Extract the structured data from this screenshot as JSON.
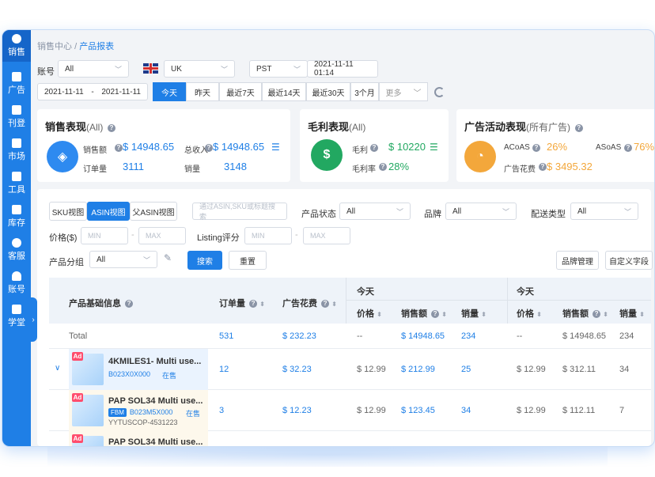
{
  "sidebar": {
    "items": [
      {
        "label": "销售",
        "icon": "pie-chart-icon"
      },
      {
        "label": "广告",
        "icon": "ad-icon"
      },
      {
        "label": "刊登",
        "icon": "document-icon"
      },
      {
        "label": "市场",
        "icon": "market-icon"
      },
      {
        "label": "工具",
        "icon": "tools-icon"
      },
      {
        "label": "库存",
        "icon": "warehouse-icon"
      },
      {
        "label": "客服",
        "icon": "headset-icon"
      },
      {
        "label": "账号",
        "icon": "user-icon"
      },
      {
        "label": "学堂",
        "icon": "classroom-icon"
      }
    ],
    "expand_arrow": "›"
  },
  "breadcrumb": {
    "root": "销售中心",
    "sep": "/",
    "current": "产品报表"
  },
  "filters": {
    "account_label": "账号",
    "account_value": "All",
    "site_value": "UK",
    "tz_value": "PST",
    "now_time": "2021-11-11 01:14",
    "date_start": "2021-11-11",
    "date_sep": "-",
    "date_end": "2021-11-11",
    "ranges": [
      "今天",
      "昨天",
      "最近7天",
      "最近14天",
      "最近30天",
      "3个月",
      "更多"
    ]
  },
  "sales_card": {
    "title": "销售表现",
    "sub": "(All)",
    "rows": [
      {
        "label": "销售额",
        "value": "$ 14948.65"
      },
      {
        "label": "订单量",
        "value": "3111"
      }
    ],
    "rows2": [
      {
        "label": "总收入",
        "value": "$ 14948.65"
      },
      {
        "label": "销量",
        "value": "3148"
      }
    ]
  },
  "profit_card": {
    "title": "毛利表现",
    "sub": "(All)",
    "rows": [
      {
        "label": "毛利",
        "value": "$ 10220"
      },
      {
        "label": "毛利率",
        "value": "28%"
      }
    ]
  },
  "ad_card": {
    "title": "广告活动表现",
    "sub": "(所有广告)",
    "rows": [
      {
        "label": "ACoAS",
        "value": "26%"
      },
      {
        "label": "广告花费",
        "value": "$ 3495.32"
      }
    ],
    "rows2": [
      {
        "label": "ASoAS",
        "value": "76%"
      }
    ]
  },
  "views": [
    "SKU视图",
    "ASIN视图",
    "父ASIN视图"
  ],
  "search": {
    "placeholder": "通过ASIN,SKU或标题搜索"
  },
  "product_status": {
    "label": "产品状态",
    "value": "All"
  },
  "brand": {
    "label": "品牌",
    "value": "All"
  },
  "ship_type": {
    "label": "配送类型",
    "value": "All"
  },
  "price": {
    "label": "价格($)",
    "min": "MIN",
    "max": "MAX",
    "sep": "-"
  },
  "listing_score": {
    "label": "Listing评分",
    "min": "MIN",
    "max": "MAX",
    "sep": "-"
  },
  "group": {
    "label": "产品分组",
    "value": "All"
  },
  "actions": {
    "search": "搜索",
    "reset": "重置",
    "brand_mgmt": "品牌管理",
    "custom_fields": "自定义字段"
  },
  "table": {
    "col_product": "产品基础信息",
    "col_orders": "订单量",
    "col_ad_spend": "广告花费",
    "group1": "今天",
    "group2": "今天",
    "col_price": "价格",
    "col_sales": "销售额",
    "col_units": "销量",
    "total": {
      "label": "Total",
      "orders": "531",
      "ad": "$ 232.23",
      "p1": "--",
      "s1": "$ 14948.65",
      "u1": "234",
      "p2": "--",
      "s2": "$ 14948.65",
      "u2": "234"
    },
    "rows": [
      {
        "ad": "Ad",
        "title": "4KMILES1- Multi use...",
        "sku": "B023X0X000",
        "status": "在售",
        "orders": "12",
        "adspend": "$ 32.23",
        "p1": "$ 12.99",
        "s1": "$ 212.99",
        "u1": "25",
        "p2": "$ 12.99",
        "s2": "$ 312.11",
        "u2": "34"
      },
      {
        "ad": "Ad",
        "title": "PAP SOL34 Multi use...",
        "fbm": "FBM",
        "sku": "B023M5X000",
        "status": "在售",
        "sku2": "YYTUSCOP-4531223",
        "orders": "3",
        "adspend": "$ 12.23",
        "p1": "$ 12.99",
        "s1": "$ 123.45",
        "u1": "34",
        "p2": "$ 12.99",
        "s2": "$ 112.11",
        "u2": "7"
      },
      {
        "ad": "Ad",
        "title": "PAP SOL34 Multi use..."
      }
    ]
  },
  "colors": {
    "primary": "#1f7fe6",
    "green": "#22a861",
    "orange": "#f3a73b"
  }
}
